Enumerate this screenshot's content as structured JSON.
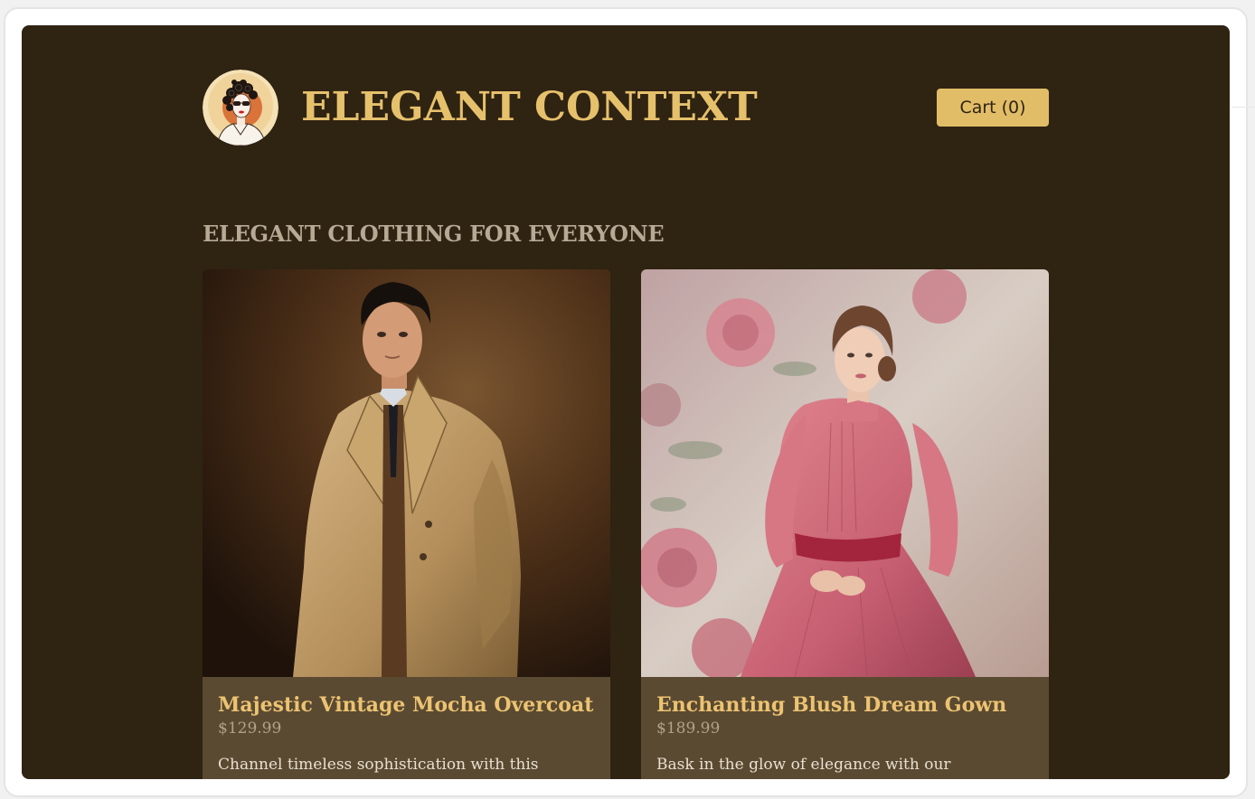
{
  "header": {
    "brand_name": "ELEGANT CONTEXT",
    "logo_icon": "vintage-lady-portrait-icon",
    "cart_label": "Cart (0)"
  },
  "main": {
    "section_title": "ELEGANT CLOTHING FOR EVERYONE",
    "products": [
      {
        "name": "Majestic Vintage Mocha Overcoat",
        "price": "$129.99",
        "description": "Channel timeless sophistication with this stunning mocha overcoat. Crafted for the"
      },
      {
        "name": "Enchanting Blush Dream Gown",
        "price": "$189.99",
        "description": "Bask in the glow of elegance with our Enchanting Blush Dream Gown. Exude the quality of"
      }
    ]
  },
  "colors": {
    "page_background": "#2f2312",
    "accent_gold": "#e2bd68",
    "card_background": "#5b4a32",
    "product_name": "#ecc371",
    "section_title": "#b6aa95"
  }
}
